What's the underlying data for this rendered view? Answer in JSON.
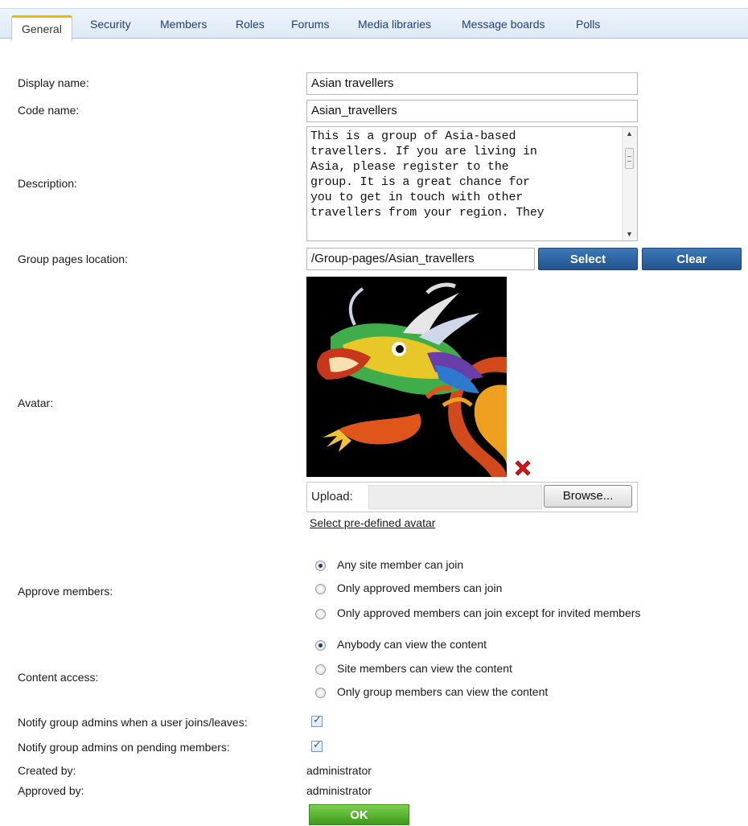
{
  "tabs": [
    "General",
    "Security",
    "Members",
    "Roles",
    "Forums",
    "Media libraries",
    "Message boards",
    "Polls"
  ],
  "form": {
    "display_name_label": "Display name:",
    "display_name_value": "Asian travellers",
    "code_name_label": "Code name:",
    "code_name_value": "Asian_travellers",
    "description_label": "Description:",
    "description_value": "This is a group of Asia-based\ntravellers. If you are living in\nAsia, please register to the\ngroup. It is a great chance for\nyou to get in touch with other\ntravellers from your region. They",
    "location_label": "Group pages location:",
    "location_value": "/Group-pages/Asian_travellers",
    "select_button": "Select",
    "clear_button": "Clear",
    "avatar_label": "Avatar:",
    "upload_label": "Upload:",
    "browse_button": "Browse...",
    "predefined_avatar_link": "Select pre-defined avatar",
    "approve_label": "Approve members:",
    "approve_options": [
      "Any site member can join",
      "Only approved members can join",
      "Only approved members can join except for invited members"
    ],
    "approve_selected": 0,
    "access_label": "Content access:",
    "access_options": [
      "Anybody can view the content",
      "Site members can view the content",
      "Only group members can view the content"
    ],
    "access_selected": 0,
    "notify_joins_label": "Notify group admins when a user joins/leaves:",
    "notify_joins_checked": true,
    "notify_pending_label": "Notify group admins on pending members:",
    "notify_pending_checked": true,
    "created_by_label": "Created by:",
    "created_by_value": "administrator",
    "approved_by_label": "Approved by:",
    "approved_by_value": "administrator",
    "ok_button": "OK"
  },
  "colors": {
    "tab_accent": "#f4b400",
    "button_blue": "#2c5f9e",
    "ok_green": "#4fae25",
    "delete_red": "#d0161c"
  }
}
